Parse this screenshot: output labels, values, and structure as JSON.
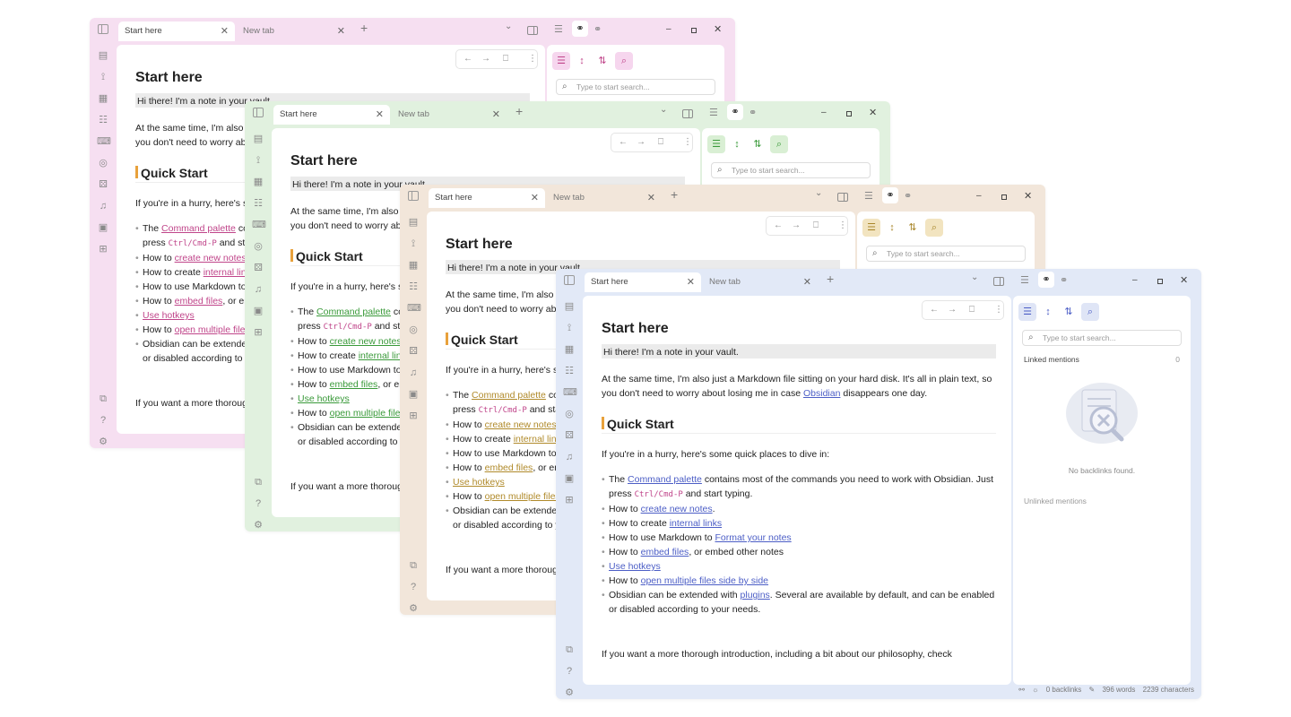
{
  "windows": [
    {
      "theme": "pink",
      "frame": "#f6dff1",
      "link": "#c0458a",
      "accent": "#c0458a",
      "accent_bg": "#f6d6ee"
    },
    {
      "theme": "green",
      "frame": "#e1f1df",
      "link": "#3a9a3a",
      "accent": "#3a9a3a",
      "accent_bg": "#d9efd4"
    },
    {
      "theme": "tan",
      "frame": "#f2e6da",
      "link": "#b08a2a",
      "accent": "#a8862a",
      "accent_bg": "#f2e4c0"
    },
    {
      "theme": "blue",
      "frame": "#e2e9f7",
      "link": "#4c5ec6",
      "accent": "#4c5ec6",
      "accent_bg": "#dfe5f6"
    }
  ],
  "tabs": {
    "active": "Start here",
    "inactive": "New tab"
  },
  "doc": {
    "title": "Start here",
    "intro": "Hi there! I'm a note in your vault.",
    "para1_before": "At the same time, I'm also just a Markdown file sitting on your hard disk. It's all in plain text, so you don't need to worry about losing me in case ",
    "para1_link": "Obsidian",
    "para1_after": " disappears one day.",
    "h2": "Quick Start",
    "hurry": "If you're in a hurry, here's some quick places to dive in:",
    "b1_a": "The ",
    "b1_link": "Command palette",
    "b1_b": " contains most of the commands you need to work with Obsidian. Just press ",
    "b1_code": "Ctrl/Cmd-P",
    "b1_c": " and start typing.",
    "b2_a": "How to ",
    "b2_link": "create new notes",
    "b2_b": ".",
    "b3_a": "How to create ",
    "b3_link": "internal links",
    "b4_a": "How to use Markdown to ",
    "b4_link": "Format your notes",
    "b5_a": "How to ",
    "b5_link": "embed files",
    "b5_b": ", or embed other notes",
    "b6_link": "Use hotkeys",
    "b7_a": "How to ",
    "b7_link": "open multiple files side by side",
    "b8_a": "Obsidian can be extended with ",
    "b8_link": "plugins",
    "b8_b": ". Several are available by default, and can be enabled or disabled according to your needs.",
    "last": "If you want a more thorough introduction, including a bit about our philosophy, check"
  },
  "panel": {
    "search_placeholder": "Type to start search...",
    "linked": "Linked mentions",
    "linked_count": "0",
    "no_backlinks": "No backlinks found.",
    "unlinked": "Unlinked mentions"
  },
  "status": {
    "backlinks": "0 backlinks",
    "words": "396 words",
    "chars": "2239 characters"
  }
}
